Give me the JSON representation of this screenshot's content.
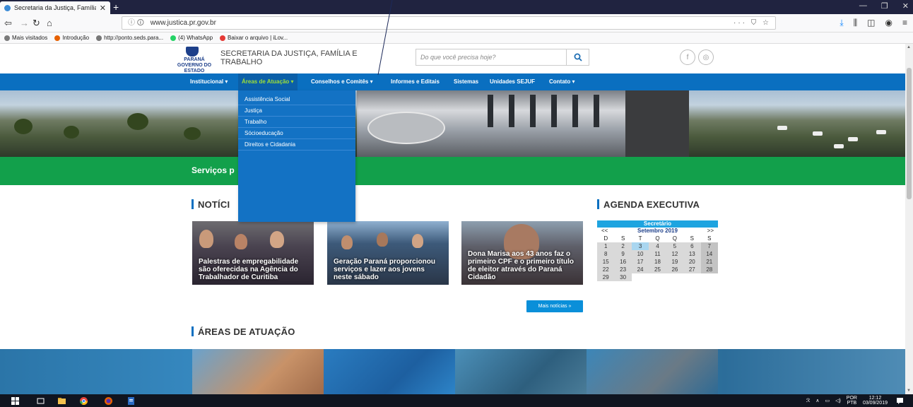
{
  "browser": {
    "tab_title": "Secretaria da Justiça, Família e",
    "url_prefix": "ⓘ 🛈",
    "url": "www.justica.pr.gov.br",
    "url_actions": "··· ⛉ ☆",
    "bookmarks": [
      {
        "label": "Mais visitados",
        "color": "#7a7a7a"
      },
      {
        "label": "Introdução",
        "color": "#e66000"
      },
      {
        "label": "http://ponto.seds.para...",
        "color": "#777"
      },
      {
        "label": "(4) WhatsApp",
        "color": "#25d366"
      },
      {
        "label": "Baixar o arquivo | iLov...",
        "color": "#e53935"
      }
    ]
  },
  "header": {
    "logo_text": "PARANÁ GOVERNO DO ESTADO",
    "site_name": "SECRETARIA DA JUSTIÇA, FAMÍLIA E TRABALHO",
    "search_placeholder": "Do que você precisa hoje?"
  },
  "nav": {
    "items": [
      {
        "label": "Institucional ▾"
      },
      {
        "label": "Áreas de Atuação ▾"
      },
      {
        "label": "Conselhos e Comitês ▾"
      },
      {
        "label": "Informes e Editais"
      },
      {
        "label": "Sistemas"
      },
      {
        "label": "Unidades SEJUF"
      },
      {
        "label": "Contato ▾"
      }
    ]
  },
  "dropdown": {
    "items": [
      "Assistência Social",
      "Justiça",
      "Trabalho",
      "Sócioeducação",
      "Direitos e Cidadania"
    ]
  },
  "services_title": "Serviços p",
  "news": {
    "title": "NOTÍCI",
    "cards": [
      {
        "caption": "Palestras de empregabilidade são oferecidas na Agência do Trabalhador de Curitiba"
      },
      {
        "caption": "Geração Paraná proporcionou serviços e lazer aos jovens neste sábado"
      },
      {
        "caption": "Dona Marisa aos 43 anos faz o primeiro CPF e o primeiro título de eleitor através do Paraná Cidadão"
      }
    ],
    "more": "Mais notícias »"
  },
  "agenda": {
    "title": "AGENDA EXECUTIVA",
    "calendar_header": "Secretário",
    "prev": "<<",
    "next": ">>",
    "month": "Setembro 2019",
    "weekdays": [
      "D",
      "S",
      "T",
      "Q",
      "Q",
      "S",
      "S"
    ],
    "weeks": [
      [
        "1",
        "2",
        "3",
        "4",
        "5",
        "6",
        "7"
      ],
      [
        "8",
        "9",
        "10",
        "11",
        "12",
        "13",
        "14"
      ],
      [
        "15",
        "16",
        "17",
        "18",
        "19",
        "20",
        "21"
      ],
      [
        "22",
        "23",
        "24",
        "25",
        "26",
        "27",
        "28"
      ],
      [
        "29",
        "30",
        "",
        "",
        "",
        "",
        ""
      ]
    ],
    "today": "3"
  },
  "areas": {
    "title": "ÁREAS DE ATUAÇÃO"
  },
  "taskbar": {
    "lang_top": "POR",
    "lang_bottom": "PTB",
    "time": "12:12",
    "date": "03/09/2019"
  }
}
